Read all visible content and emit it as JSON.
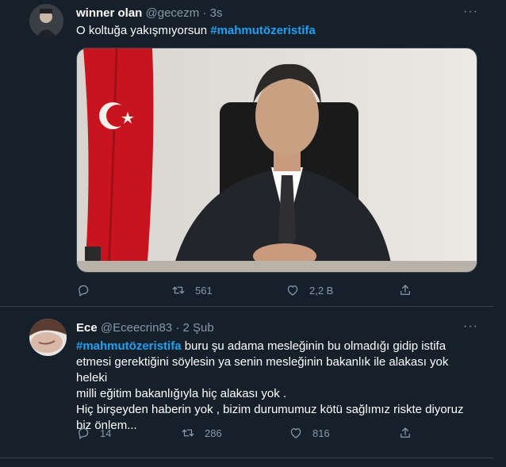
{
  "tweets": [
    {
      "display_name": "winner olan",
      "handle": "@gecezm",
      "separator": "·",
      "time": "3s",
      "text_before_hashtag": "O koltuğa yakışmıyorsun ",
      "hashtag": "#mahmutözeristifa",
      "actions": {
        "reply": "",
        "retweet": "561",
        "like": "2,2 B",
        "share": ""
      }
    },
    {
      "display_name": "Ece",
      "handle": "@Eceecrin83",
      "separator": "·",
      "time": "2 Şub",
      "hashtag": "#mahmutözeristifa",
      "line1_rest": " buru şu adama mesleğinin bu olmadığı gidip istifa",
      "line2": "etmesi gerektiğini söylesin ya senin mesleğinin bakanlık ile alakası yok heleki",
      "line3": "milli eğitim bakanlığıyla hiç alakası yok .",
      "line4": "Hiç birşeyden haberin yok , bizim durumumuz kötü sağlımız riskte diyoruz",
      "line5": "biz önlem...",
      "actions": {
        "reply": "14",
        "retweet": "286",
        "like": "816",
        "share": ""
      }
    }
  ],
  "more_label": "···",
  "colors": {
    "background": "#15202b",
    "accent": "#1da1f2",
    "muted": "#8899a6",
    "divider": "#38444d"
  }
}
